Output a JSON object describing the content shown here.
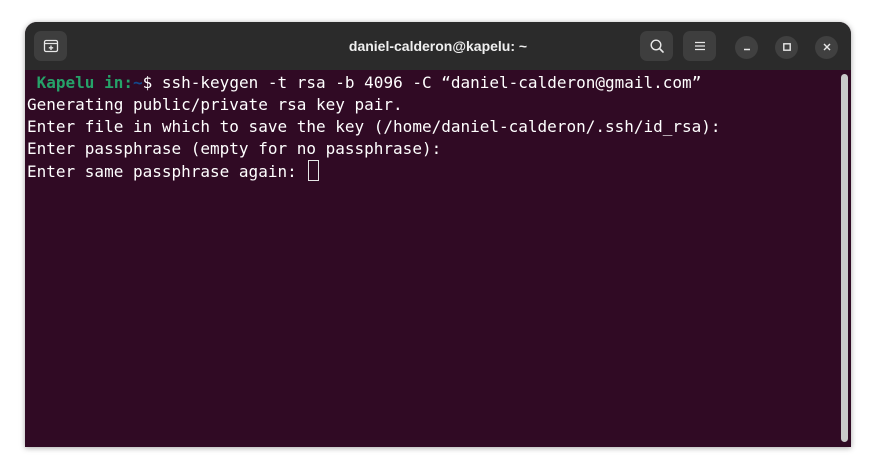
{
  "window": {
    "title": "daniel-calderon@kapelu: ~"
  },
  "terminal": {
    "prompt_user": " Kapelu in:",
    "prompt_path": "~",
    "prompt_symbol": "$",
    "command": " ssh-keygen -t rsa -b 4096 -C “daniel-calderon@gmail.com”",
    "output_lines": [
      "Generating public/private rsa key pair.",
      "Enter file in which to save the key (/home/daniel-calderon/.ssh/id_rsa):",
      "Enter passphrase (empty for no passphrase):"
    ],
    "current_line": "Enter same passphrase again: "
  },
  "icons": {
    "new_tab": "new-tab-icon",
    "search": "search-icon",
    "menu": "hamburger-menu-icon",
    "minimize": "minimize-icon",
    "maximize": "maximize-icon",
    "close": "close-icon"
  },
  "colors": {
    "terminal_bg": "#300a24",
    "prompt_user": "#26a269",
    "prompt_path": "#12488b",
    "titlebar_bg": "#2b2b2b"
  }
}
